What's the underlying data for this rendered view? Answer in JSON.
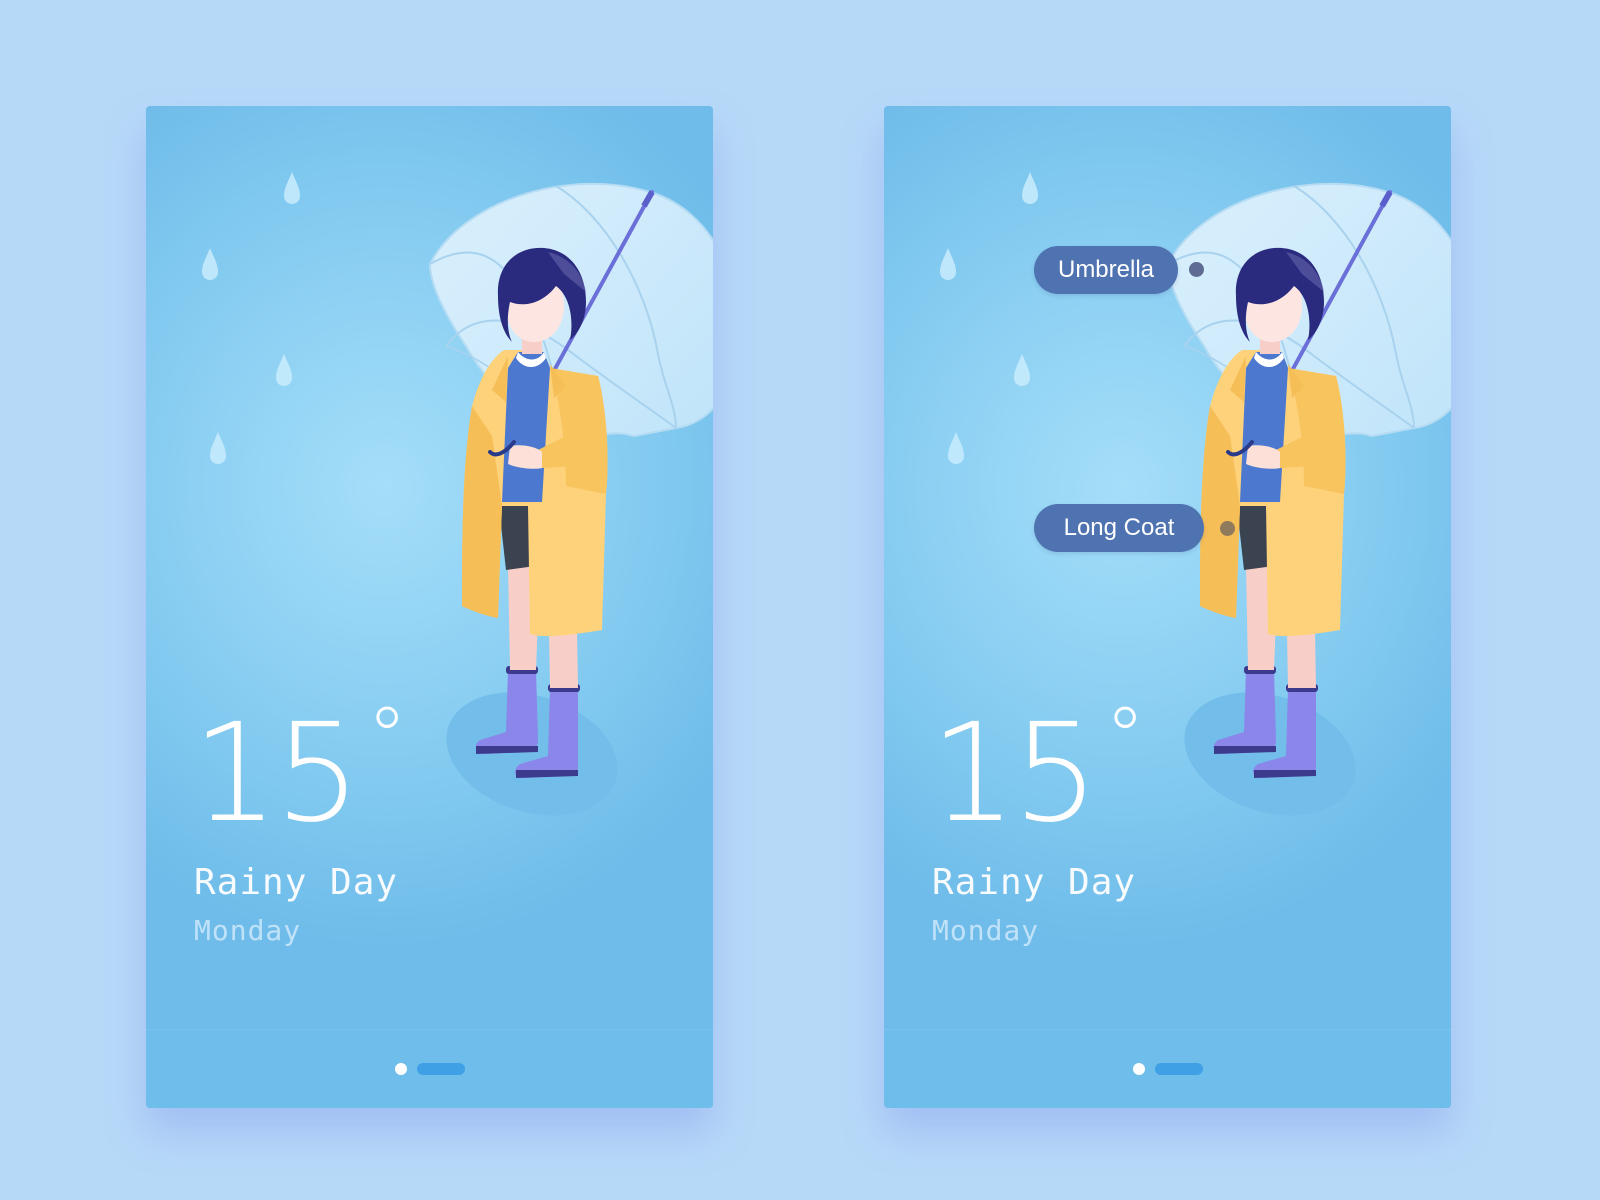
{
  "screens": [
    {
      "temperature": "15",
      "degree_symbol": "°",
      "condition": "Rainy Day",
      "day": "Monday",
      "pager": {
        "active_index": 0,
        "count": 2
      }
    },
    {
      "temperature": "15",
      "degree_symbol": "°",
      "condition": "Rainy Day",
      "day": "Monday",
      "tags": {
        "umbrella": "Umbrella",
        "coat": "Long Coat"
      },
      "pager": {
        "active_index": 0,
        "count": 2
      }
    }
  ],
  "colors": {
    "background": "#b7d9f8",
    "screen_bg": "#8dd0f3",
    "coat": "#fdd27a",
    "boots": "#8b86e9",
    "hair": "#2a2a7e",
    "tag_bg": "#4f73b0",
    "pager_active": "#ffffff",
    "pager_inactive": "#3fa0e6"
  },
  "icons": [
    "raindrop-icon",
    "umbrella-illustration",
    "person-illustration"
  ]
}
